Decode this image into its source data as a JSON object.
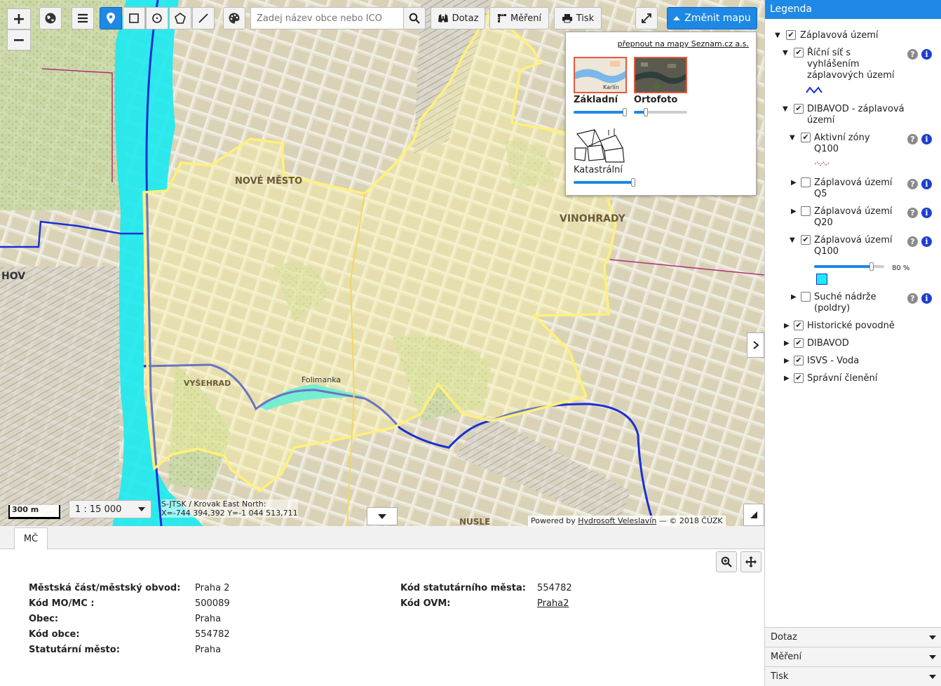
{
  "toolbar": {
    "zoom_in": "+",
    "zoom_out": "−",
    "search_placeholder": "Zadej název obce nebo IČO",
    "query_label": "Dotaz",
    "measure_label": "Měření",
    "print_label": "Tisk",
    "change_map_label": "Změnit mapu"
  },
  "map": {
    "labels": {
      "nove_mesto": "NOVÉ MĚSTO",
      "vinohrady": "VINOHRADY",
      "vysehrad": "VYŠEHRAD",
      "folimanka": "Folimanka",
      "hov": "HOV",
      "nusle": "NUSLE"
    },
    "scale_bar": "300 m",
    "scale": "1 : 15 000",
    "crs": "S-JTSK / Krovak East North:",
    "coordinates": "X=-744 394,392 Y=-1 044 513,711",
    "powered_prefix": "Powered by",
    "powered_link": "Hydrosoft Veleslavín",
    "powered_suffix": "— © 2018 ČÚZK"
  },
  "switcher": {
    "seznam_link": "přepnout na mapy Seznam.cz a.s.",
    "thumb_text": "Karlín",
    "layers": [
      {
        "label": "Základní",
        "opacity": 1.0
      },
      {
        "label": "Ortofoto",
        "opacity": 0.2
      },
      {
        "label": "Katastrální",
        "opacity": 1.0
      }
    ]
  },
  "panel": {
    "tab": "MČ",
    "left": [
      {
        "label": "Městská část/městský obvod:",
        "value": "Praha 2"
      },
      {
        "label": "Kód MO/MC :",
        "value": "500089"
      },
      {
        "label": "Obec:",
        "value": "Praha"
      },
      {
        "label": "Kód obce:",
        "value": "554782"
      },
      {
        "label": "Statutární město:",
        "value": "Praha"
      }
    ],
    "right": [
      {
        "label": "Kód statutárního města:",
        "value": "554782"
      },
      {
        "label": "Kód OVM:",
        "value": "Praha2"
      }
    ]
  },
  "legend": {
    "title": "Legenda",
    "items": [
      {
        "label": "Záplavová území"
      },
      {
        "label": "Říční síť s vyhlášením záplavových území"
      },
      {
        "label": "DIBAVOD - záplavová území"
      },
      {
        "label": "Aktivní zóny Q100"
      },
      {
        "label": "Záplavová území Q5"
      },
      {
        "label": "Záplavová území Q20"
      },
      {
        "label": "Záplavová území Q100"
      },
      {
        "label": "Suché nádrže (poldry)"
      },
      {
        "label": "Historické povodně"
      },
      {
        "label": "DIBAVOD"
      },
      {
        "label": "ISVS - Voda"
      },
      {
        "label": "Správní členění"
      }
    ],
    "q100_opacity": "80 %",
    "q100_opacity_value": 0.8,
    "accordion": [
      "Dotaz",
      "Měření",
      "Tisk"
    ]
  },
  "colors": {
    "accent": "#1e88e5",
    "flood": "#1ee9f0",
    "river": "#1a2fd6",
    "boundary": "#fff17a"
  }
}
